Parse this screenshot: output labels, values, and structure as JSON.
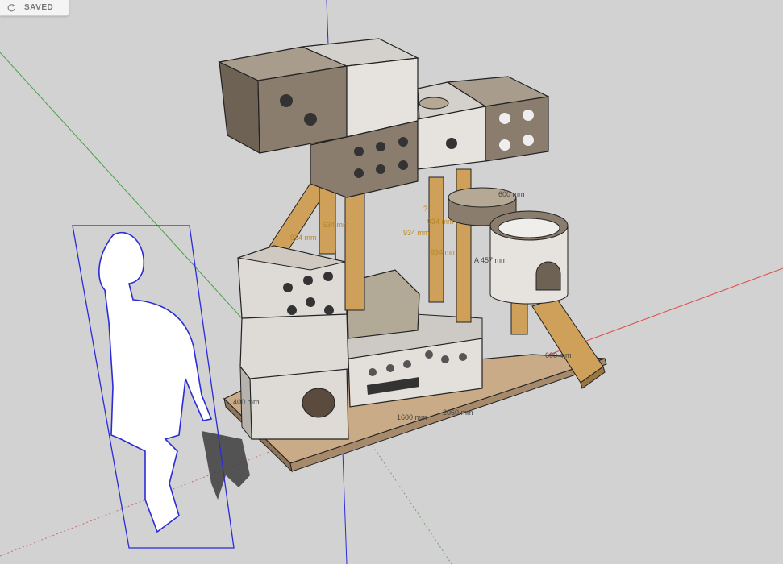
{
  "status": {
    "saved_label": "SAVED",
    "icon": "refresh-icon"
  },
  "dimensions": {
    "depth": "400 mm",
    "inner_width": "1600 mm",
    "total_width": "2060 mm",
    "ramp_depth": "600 mm",
    "post_height_a": "634 mm",
    "post_height_b": "934 mm",
    "post_height_c": "934 mm",
    "post_height_d": "934 mm",
    "post_height_e": "934 mm",
    "post_q": "?",
    "bowl_radius": "A 457 mm",
    "bowl_dia": "600 mm"
  },
  "colors": {
    "axis_red": "#e04a4a",
    "axis_green": "#49a049",
    "axis_blue": "#2b2bd8",
    "wood": "#cfa05a",
    "panel": "#e3e0dc"
  }
}
